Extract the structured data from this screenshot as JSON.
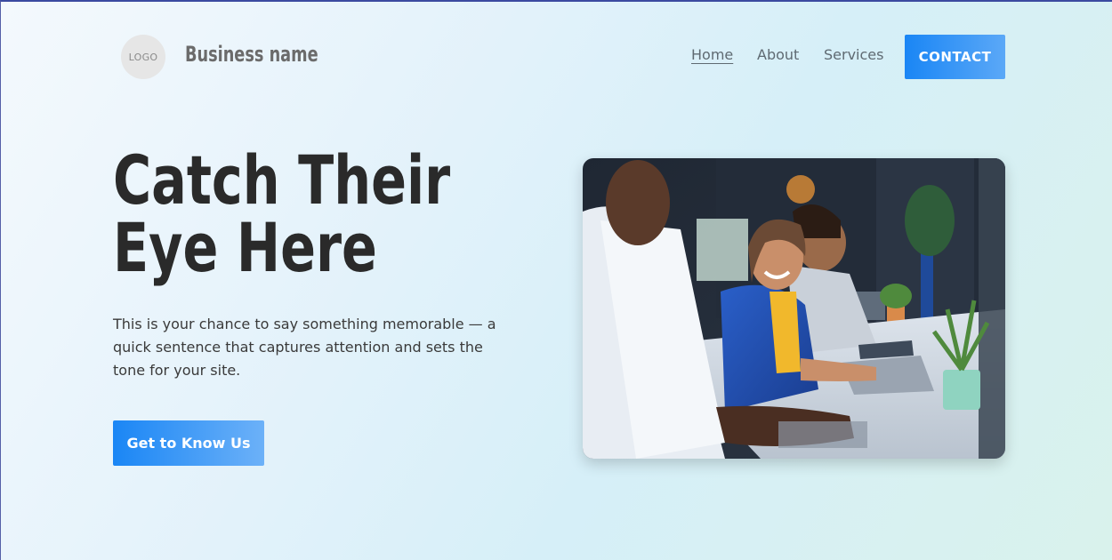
{
  "header": {
    "logo_text": "LOGO",
    "business_name": "Business name",
    "nav": [
      {
        "label": "Home"
      },
      {
        "label": "About"
      },
      {
        "label": "Services"
      }
    ],
    "contact_label": "CONTACT"
  },
  "hero": {
    "headline_line1": "Catch Their",
    "headline_line2": "Eye Here",
    "subtext": "This is your chance to say something memorable — a quick sentence that captures attention and sets the tone for your site.",
    "cta_label": "Get to Know Us"
  },
  "colors": {
    "accent": "#1a86f5",
    "headline": "#2a2a2a",
    "nav_text": "#5f6a72"
  }
}
